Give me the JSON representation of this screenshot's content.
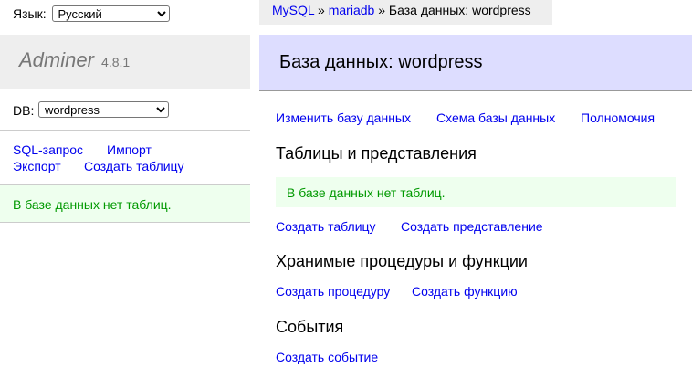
{
  "lang": {
    "label": "Язык:",
    "selected": "Русский"
  },
  "logo": {
    "name": "Adminer",
    "version": "4.8.1"
  },
  "db": {
    "label": "DB:",
    "selected": "wordpress"
  },
  "sidebar_links": {
    "sql": "SQL-запрос",
    "import": "Импорт",
    "export": "Экспорт",
    "create_table": "Создать таблицу"
  },
  "sidebar_message": "В базе данных нет таблиц.",
  "breadcrumb": {
    "driver": "MySQL",
    "sep1": "»",
    "server": "mariadb",
    "sep2": "»",
    "current": "База данных: wordpress"
  },
  "page_title": "База данных: wordpress",
  "top_links": {
    "alter_db": "Изменить базу данных",
    "schema": "Схема базы данных",
    "privileges": "Полномочия"
  },
  "tables_section": {
    "heading": "Таблицы и представления",
    "message": "В базе данных нет таблиц.",
    "create_table": "Создать таблицу",
    "create_view": "Создать представление"
  },
  "routines_section": {
    "heading": "Хранимые процедуры и функции",
    "create_procedure": "Создать процедуру",
    "create_function": "Создать функцию"
  },
  "events_section": {
    "heading": "События",
    "create_event": "Создать событие"
  }
}
